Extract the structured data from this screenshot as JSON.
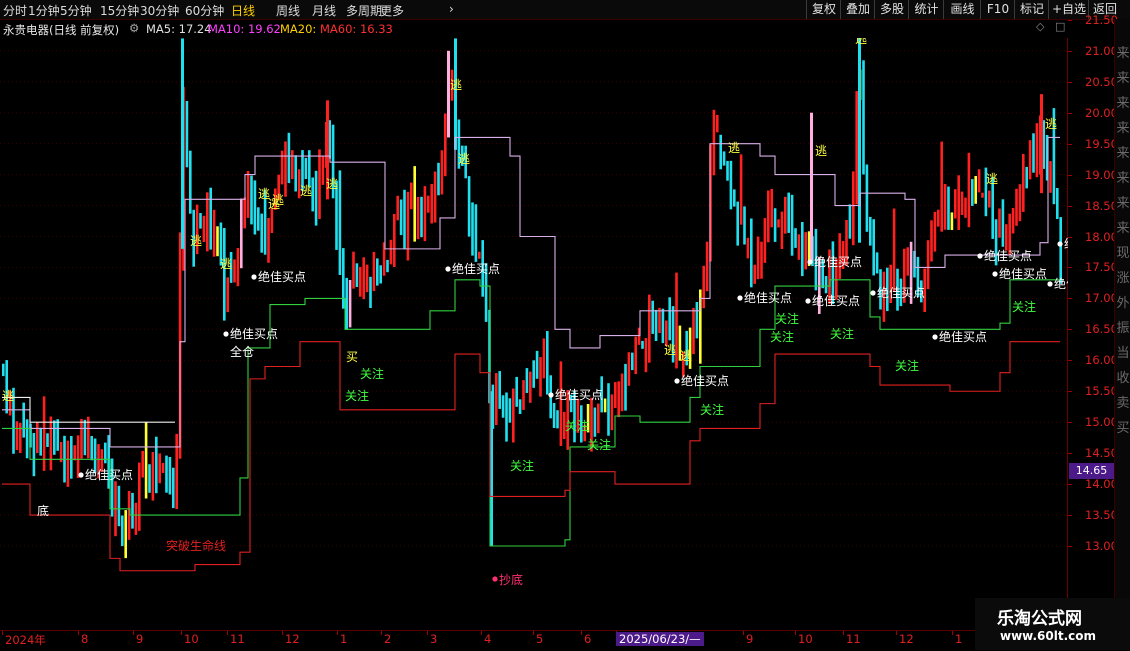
{
  "toolbar": {
    "periods": [
      "分时",
      "1分钟",
      "5分钟",
      "15分钟",
      "30分钟",
      "60分钟",
      "日线",
      "周线",
      "月线",
      "多周期",
      "更多"
    ],
    "active_period": "日线",
    "right_buttons": [
      "复权",
      "叠加",
      "多股",
      "统计",
      "画线",
      "F10",
      "标记",
      "+自选",
      "返回"
    ]
  },
  "header": {
    "stock_title": "永贵电器(日线 前复权)",
    "ma5": "MA5: 17.24",
    "ma10": "MA10: 19.62",
    "ma20": "MA20:",
    "ma60": "MA60: 16.33"
  },
  "price_axis": [
    "21.50",
    "21.00",
    "20.50",
    "20.00",
    "19.50",
    "19.00",
    "18.50",
    "18.00",
    "17.50",
    "17.00",
    "16.50",
    "16.00",
    "15.50",
    "15.00",
    "14.50",
    "14.00",
    "13.50",
    "13.00"
  ],
  "current_price": "14.65",
  "x_axis": [
    "2024年",
    "8",
    "9",
    "10",
    "11",
    "12",
    "1",
    "2",
    "3",
    "4",
    "5",
    "6",
    "2025/06/23/—",
    "9",
    "10",
    "11",
    "12",
    "1",
    "2"
  ],
  "annotations": {
    "escape": "逃",
    "best_buy": "绝佳买点",
    "watch": "关注",
    "buy": "买",
    "bottom": "底",
    "full_position": "全仓",
    "breakthrough": "突破生命线",
    "bottom_fish": "抄底"
  },
  "right_strip_chars": "来来来来来来来来现涨外振当收卖买",
  "watermark": {
    "line1": "乐淘公式网",
    "line2": "www.60lt.com"
  },
  "colors": {
    "bg": "#000000",
    "up": "#ff2020",
    "down": "#20e0f0",
    "yellow_bar": "#ffff33",
    "pink_bar": "#ffb0e0",
    "line_red": "#e02020",
    "line_green": "#30d040",
    "line_violet": "#d8b0e8",
    "line_white": "#f0f0f0",
    "label_yellow": "#ffff40",
    "label_white": "#ffffff",
    "label_green": "#40ff40",
    "ma5_color": "#e0e0e0",
    "ma10_color": "#ff40ff",
    "ma20_color": "#ffd000",
    "ma60_color": "#ff3030"
  }
}
